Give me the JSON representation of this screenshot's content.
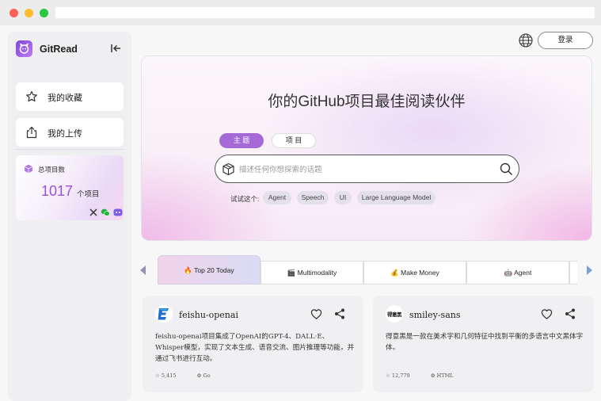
{
  "app": {
    "name": "GitRead"
  },
  "sidebar": {
    "items": [
      {
        "label": "我的收藏",
        "icon": "star-icon"
      },
      {
        "label": "我的上传",
        "icon": "upload-icon"
      }
    ],
    "stats": {
      "title": "总项目数",
      "count": "1017",
      "unit": "个项目"
    },
    "social": [
      "x-icon",
      "wechat-icon",
      "discord-icon"
    ]
  },
  "header": {
    "login_label": "登录",
    "language_icon": "globe-icon"
  },
  "hero": {
    "title": "你的GitHub项目最佳阅读伙伴",
    "tabs": [
      {
        "label": "主 题",
        "active": true
      },
      {
        "label": "项 目",
        "active": false
      }
    ],
    "search": {
      "placeholder": "描述任何你想探索的话题",
      "value": ""
    },
    "try_label": "试试这个:",
    "suggestions": [
      "Agent",
      "Speech",
      "UI",
      "Large Language Model"
    ]
  },
  "categories": [
    {
      "label": "🔥 Top 20 Today",
      "active": true
    },
    {
      "label": "🎬 Multimodality",
      "active": false
    },
    {
      "label": "💰 Make Money",
      "active": false
    },
    {
      "label": "🤖 Agent",
      "active": false
    }
  ],
  "cards": [
    {
      "name": "feishu-openai",
      "description": "feishu-openai项目集成了OpenAI的GPT-4、DALL·E、Whisper模型，实现了文本生成、语音交流、图片推理等功能，并通过飞书进行互动。",
      "stars": "5,415",
      "language": "Go"
    },
    {
      "name": "smiley-sans",
      "avatar_text": "得意黑",
      "description": "得意黑是一款在美术字和几何特征中找到平衡的多语言中文黑体字体。",
      "stars": "12,779",
      "language": "HTML"
    }
  ],
  "colors": {
    "accent": "#a66ad8",
    "stat_number": "#9c50d8"
  }
}
